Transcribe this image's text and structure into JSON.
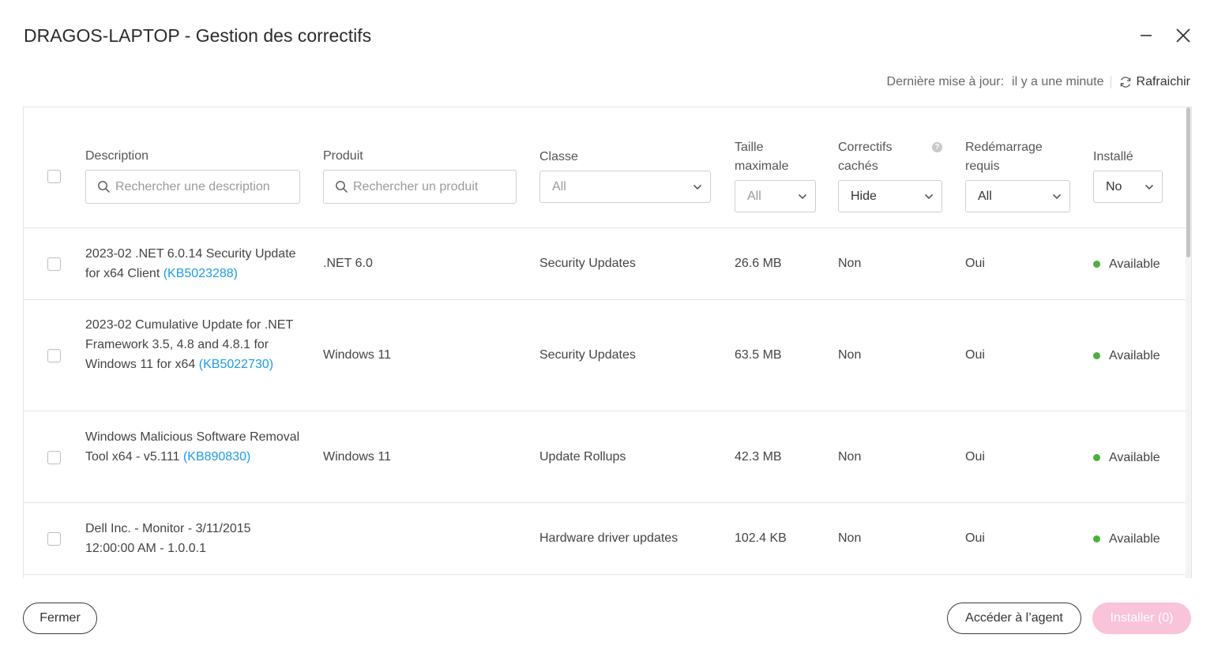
{
  "window": {
    "title": "DRAGOS-LAPTOP - Gestion des correctifs",
    "minimize_icon": "minimize-icon",
    "close_icon": "close-icon"
  },
  "update_info": {
    "label": "Dernière mise à jour:",
    "value": "il y a une minute",
    "refresh_label": "Rafraichir"
  },
  "table": {
    "headers": {
      "description": "Description",
      "product": "Produit",
      "class": "Classe",
      "max_size_line1": "Taille",
      "max_size_line2": "maximale",
      "hidden_line1": "Correctifs",
      "hidden_line2": "cachés",
      "reboot_line1": "Redémarrage",
      "reboot_line2": "requis",
      "installed": "Installé"
    },
    "filters": {
      "description_placeholder": "Rechercher une description",
      "product_placeholder": "Rechercher un produit",
      "class_value": "All",
      "max_size_value": "All",
      "hidden_value": "Hide",
      "reboot_value": "All",
      "installed_value": "No"
    },
    "help_icon_glyph": "?",
    "rows": [
      {
        "description": "2023-02 .NET 6.0.14 Security Update for x64 Client",
        "kb": "(KB5023288)",
        "product": ".NET 6.0",
        "class": "Security Updates",
        "size": "26.6 MB",
        "hidden": "Non",
        "reboot": "Oui",
        "status": "Available"
      },
      {
        "description": "2023-02 Cumulative Update for .NET Framework 3.5, 4.8 and 4.8.1 for Windows 11 for x64",
        "kb": "(KB5022730)",
        "product": "Windows 11",
        "class": "Security Updates",
        "size": "63.5 MB",
        "hidden": "Non",
        "reboot": "Oui",
        "status": "Available"
      },
      {
        "description": "Windows Malicious Software Removal Tool x64 - v5.111",
        "kb": "(KB890830)",
        "product": "Windows 11",
        "class": "Update Rollups",
        "size": "42.3 MB",
        "hidden": "Non",
        "reboot": "Oui",
        "status": "Available"
      },
      {
        "description": "Dell Inc. - Monitor - 3/11/2015 12:00:00 AM - 1.0.0.1",
        "kb": "",
        "product": "",
        "class": "Hardware driver updates",
        "size": "102.4 KB",
        "hidden": "Non",
        "reboot": "Oui",
        "status": "Available"
      }
    ]
  },
  "footer": {
    "close_label": "Fermer",
    "agent_label": "Accéder à l’agent",
    "install_label": "Installer (0)"
  },
  "colors": {
    "link": "#1e9be9",
    "status_available": "#4caf3f",
    "install_disabled": "#f9c3d9"
  }
}
